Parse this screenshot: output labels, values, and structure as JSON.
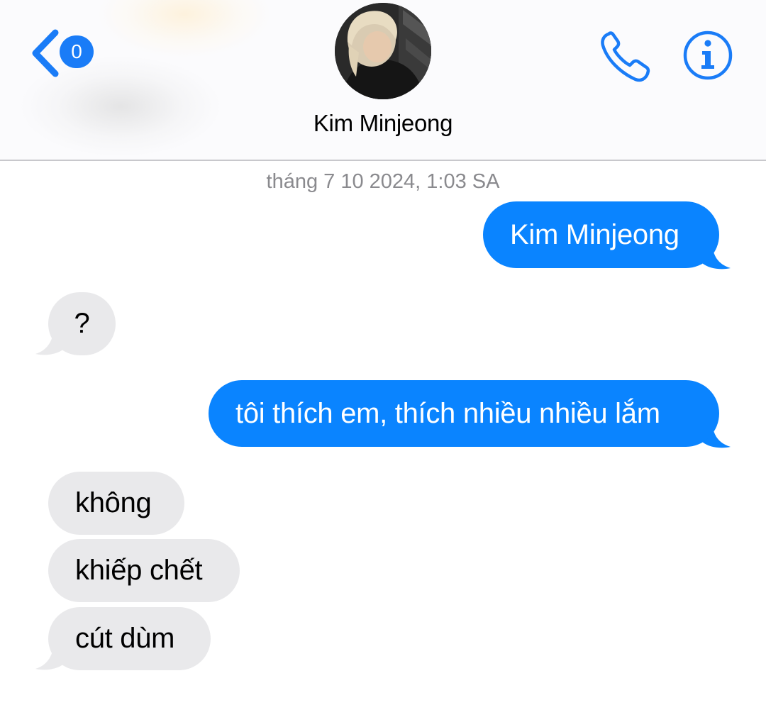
{
  "header": {
    "back_badge_count": "0",
    "contact_name": "Kim Minjeong",
    "accent_color": "#1a7cf7"
  },
  "icons": {
    "back": "chevron-left-icon",
    "phone": "phone-icon",
    "info": "info-icon"
  },
  "conversation": {
    "timestamp": "tháng 7 10 2024, 1:03 SA",
    "messages": [
      {
        "from": "me",
        "text": "Kim Minjeong"
      },
      {
        "from": "them",
        "text": "?"
      },
      {
        "from": "me",
        "text": "tôi thích em, thích nhiều nhiều lắm"
      },
      {
        "from": "them",
        "text": "không"
      },
      {
        "from": "them",
        "text": "khiếp chết"
      },
      {
        "from": "them",
        "text": "cút dùm"
      }
    ]
  },
  "colors": {
    "sent_bubble": "#0a84ff",
    "received_bubble": "#e9e9eb",
    "timestamp_text": "#8a8a8e"
  }
}
